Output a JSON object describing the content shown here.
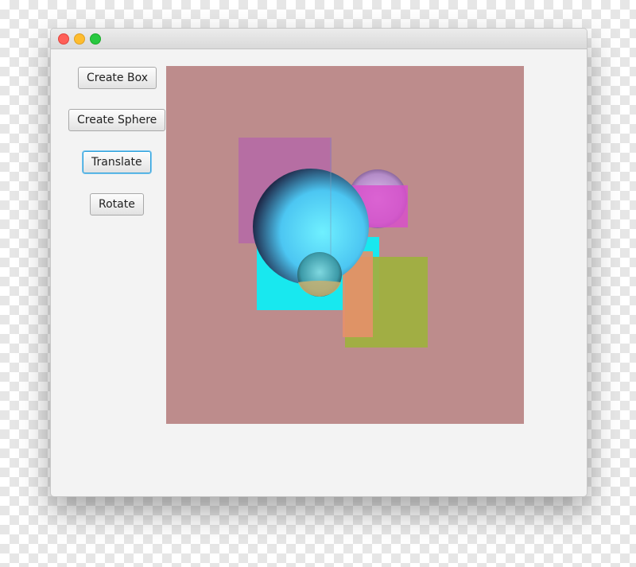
{
  "window": {
    "title": "",
    "traffic_lights": {
      "close": "#ff5f57",
      "minimize": "#febc2e",
      "zoom": "#28c840"
    }
  },
  "buttons": {
    "create_box": "Create Box",
    "create_sphere": "Create Sphere",
    "translate": "Translate",
    "rotate": "Rotate"
  },
  "scene": {
    "background": "#bd8c8c",
    "boxes": [
      {
        "name": "violet-box",
        "color": "#b56aa6"
      },
      {
        "name": "cyan-box",
        "color": "#18e8ef"
      },
      {
        "name": "magenta-box",
        "color": "#d94ecc"
      },
      {
        "name": "orange-box",
        "color": "#e6906a"
      },
      {
        "name": "olive-box",
        "color": "#9fb040"
      }
    ],
    "spheres": [
      {
        "name": "large-blue-sphere",
        "color": "#55d8ff"
      },
      {
        "name": "small-lavender-sphere",
        "color": "#c49ed8"
      },
      {
        "name": "small-teal-sphere",
        "color": "#5ab8c8"
      }
    ]
  }
}
